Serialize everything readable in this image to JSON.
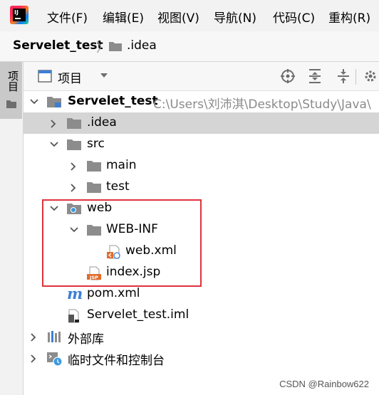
{
  "menubar": {
    "logo_text": "IJ",
    "items": [
      "文件(F)",
      "编辑(E)",
      "视图(V)",
      "导航(N)",
      "代码(C)",
      "重构(R)"
    ]
  },
  "breadcrumb": {
    "project": "Servelet_test",
    "folder": ".idea"
  },
  "side_panel": {
    "tab_label": "项目"
  },
  "toolbar": {
    "view_label": "项目"
  },
  "tree": {
    "root": {
      "label": "Servelet_test",
      "path": "C:\\Users\\刘沛淇\\Desktop\\Study\\Java\\"
    },
    "idea": ".idea",
    "src": "src",
    "main": "main",
    "test": "test",
    "web": "web",
    "webinf": "WEB-INF",
    "webxml": "web.xml",
    "indexjsp": "index.jsp",
    "pomxml": "pom.xml",
    "iml": "Servelet_test.iml",
    "extlib": "外部库",
    "scratches": "临时文件和控制台"
  },
  "watermark": "CSDN @Rainbow622",
  "colors": {
    "highlight": "#e0323c",
    "selection": "#d5d5d5",
    "folder": "#8c8c8c",
    "maven": "#3c7fd6"
  }
}
